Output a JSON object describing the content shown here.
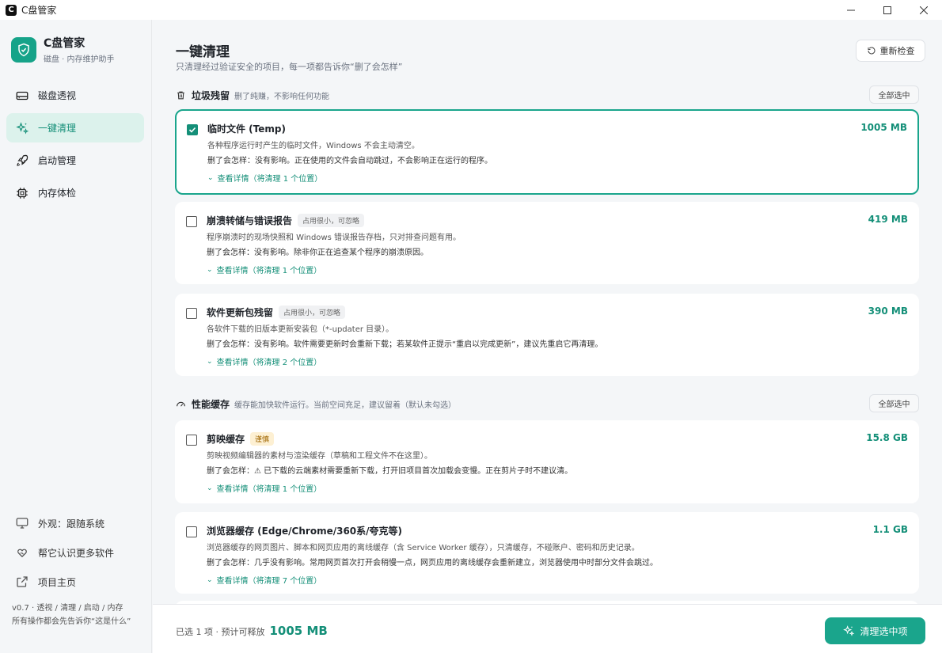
{
  "window": {
    "title": "C盘管家"
  },
  "brand": {
    "name": "C盘管家",
    "subtitle": "磁盘 · 内存维护助手",
    "accent": "#16a389"
  },
  "nav": [
    {
      "label": "磁盘透视",
      "icon": "disk-icon"
    },
    {
      "label": "一键清理",
      "icon": "sparkle-icon",
      "active": true
    },
    {
      "label": "启动管理",
      "icon": "rocket-icon"
    },
    {
      "label": "内存体检",
      "icon": "chip-icon"
    }
  ],
  "bottom_nav": [
    {
      "label": "外观：跟随系统",
      "icon": "monitor-icon"
    },
    {
      "label": "帮它认识更多软件",
      "icon": "heart-hand-icon"
    },
    {
      "label": "项目主页",
      "icon": "external-link-icon"
    }
  ],
  "version": {
    "line1": "v0.7 · 透视 / 清理 / 启动 / 内存",
    "line2": "所有操作都会先告诉你“这是什么”"
  },
  "page": {
    "title": "一键清理",
    "subtitle": "只清理经过验证安全的项目，每一项都告诉你“删了会怎样”",
    "recheck_label": "重新检查"
  },
  "sections": [
    {
      "title": "垃圾残留",
      "desc": "删了纯赚，不影响任何功能",
      "select_all": "全部选中",
      "items": [
        {
          "title": "临时文件 (Temp)",
          "tag": "",
          "size": "1005 MB",
          "checked": true,
          "desc": "各种程序运行时产生的临时文件，Windows 不会主动清空。",
          "impact": "删了会怎样：没有影响。正在使用的文件会自动跳过，不会影响正在运行的程序。",
          "detail": "查看详情（将清理 1 个位置）"
        },
        {
          "title": "崩溃转储与错误报告",
          "tag": "占用很小，可忽略",
          "size": "419 MB",
          "checked": false,
          "desc": "程序崩溃时的现场快照和 Windows 错误报告存档，只对排查问题有用。",
          "impact": "删了会怎样：没有影响。除非你正在追查某个程序的崩溃原因。",
          "detail": "查看详情（将清理 1 个位置）"
        },
        {
          "title": "软件更新包残留",
          "tag": "占用很小，可忽略",
          "size": "390 MB",
          "checked": false,
          "desc": "各软件下载的旧版本更新安装包（*-updater 目录）。",
          "impact": "删了会怎样：没有影响。软件需要更新时会重新下载；若某软件正提示“重启以完成更新”，建议先重启它再清理。",
          "detail": "查看详情（将清理 2 个位置）"
        }
      ]
    },
    {
      "title": "性能缓存",
      "desc": "缓存能加快软件运行。当前空间充足，建议留着（默认未勾选）",
      "select_all": "全部选中",
      "items": [
        {
          "title": "剪映缓存",
          "tag": "谨慎",
          "tag_type": "warn",
          "size": "15.8 GB",
          "checked": false,
          "desc": "剪映视频编辑器的素材与渲染缓存（草稿和工程文件不在这里）。",
          "impact": "删了会怎样：⚠ 已下载的云端素材需要重新下载，打开旧项目首次加载会变慢。正在剪片子时不建议清。",
          "detail": "查看详情（将清理 1 个位置）"
        },
        {
          "title": "浏览器缓存 (Edge/Chrome/360系/夸克等)",
          "tag": "",
          "size": "1.1 GB",
          "checked": false,
          "desc": "浏览器缓存的网页图片、脚本和网页应用的离线缓存（含 Service Worker 缓存），只清缓存，不碰账户、密码和历史记录。",
          "impact": "删了会怎样：几乎没有影响。常用网页首次打开会稍慢一点，网页应用的离线缓存会重新建立，浏览器使用中时部分文件会跳过。",
          "detail": "查看详情（将清理 7 个位置）"
        }
      ]
    }
  ],
  "footer": {
    "status": "已选 1 项 · 预计可释放",
    "amount": "1005 MB",
    "clean_label": "清理选中项"
  }
}
